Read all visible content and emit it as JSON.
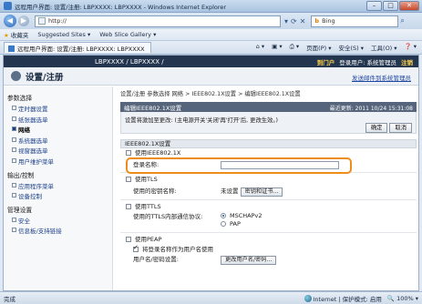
{
  "window": {
    "title": "远程用户界面: 设置/注册: LBPXXXX: LBPXXXX - Windows Internet Explorer",
    "min": "–",
    "max": "□",
    "close": "✕"
  },
  "address": {
    "url": "http://",
    "search_engine": "b",
    "search_placeholder": "Bing"
  },
  "favorites": {
    "label": "收藏夹",
    "items": [
      "Suggested Sites ▾",
      "Web Slice Gallery ▾"
    ]
  },
  "tab": {
    "label": "远程用户界面: 设置/注册: LBPXXXX: LBPXXXX",
    "commands": [
      "页面(P) ▾",
      "安全(S) ▾",
      "工具(O) ▾",
      "❓ ▾"
    ]
  },
  "header": {
    "device": "LBPXXXX / LBPXXXX /",
    "portal": "到门户",
    "login_user": "登录用户: 系统管理员",
    "logout": "注销",
    "title": "设置/注册",
    "admin_link": "发送邮件到系统管理员"
  },
  "sidebar": {
    "groups": [
      {
        "label": "参数选择",
        "items": [
          "定时器设置",
          "纸张器选单",
          "网络",
          "系统器选单",
          "视窗器选单",
          "用户维护菜单"
        ]
      },
      {
        "label": "输出/控制",
        "items": [
          "应用程序菜单",
          "设备控制"
        ]
      },
      {
        "label": "管理设置",
        "items": [
          "安全",
          "信息板/支持链接"
        ]
      }
    ],
    "selected": "网络"
  },
  "main": {
    "breadcrumb": "设置/注册 参数选择 网络 > IEEE802.1X设置 > 编辑IEEE802.1X设置",
    "panel_title": "编辑IEEE802.1X设置",
    "last_updated": "最近更新: 2011 10/24 15:31:08",
    "notice": "设置将激加至更改: (主电源开关'关闭'再'打开'后, 更改生效。)",
    "ok": "确定",
    "cancel": "取消",
    "section": "IEEE802.1X设置",
    "use_ieee": "使用IEEE802.1X",
    "login_name_label": "登录名称:",
    "login_name_value": "",
    "use_tls": "使用TLS",
    "tls_key_label": "使用的密钥名称:",
    "tls_key_value": "未设置",
    "key_cert_button": "密钥和证书...",
    "use_ttls": "使用TTLS",
    "ttls_protocol_label": "使用的TTLS内部通信协议:",
    "ttls_options": [
      "MSCHAPv2",
      "PAP"
    ],
    "use_peap": "使用PEAP",
    "use_login_as_user": "将登录名称作为用户名使用",
    "user_pass_label": "用户名/密码设置:",
    "change_user_button": "更改用户名/密码..."
  },
  "statusbar": {
    "left": "完成",
    "zone": "Internet | 保护模式: 启用",
    "zoom": "100%"
  }
}
